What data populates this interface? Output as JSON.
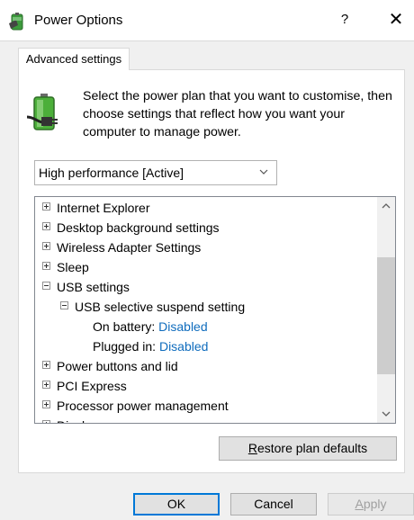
{
  "window": {
    "title": "Power Options",
    "help_label": "?",
    "close_label": "✕"
  },
  "tabs": [
    {
      "label": "Advanced settings"
    }
  ],
  "description": "Select the power plan that you want to customise, then choose settings that reflect how you want your computer to manage power.",
  "plan_select": {
    "value": "High performance [Active]"
  },
  "settings_tree": {
    "items": [
      {
        "label": "Internet Explorer",
        "expander": "plus"
      },
      {
        "label": "Desktop background settings",
        "expander": "plus"
      },
      {
        "label": "Wireless Adapter Settings",
        "expander": "plus"
      },
      {
        "label": "Sleep",
        "expander": "plus"
      },
      {
        "label": "USB settings",
        "expander": "minus"
      },
      {
        "label": "USB selective suspend setting",
        "expander": "minus"
      },
      {
        "label": "On battery:",
        "value": "Disabled"
      },
      {
        "label": "Plugged in:",
        "value": "Disabled"
      },
      {
        "label": "Power buttons and lid",
        "expander": "plus"
      },
      {
        "label": "PCI Express",
        "expander": "plus"
      },
      {
        "label": "Processor power management",
        "expander": "plus"
      },
      {
        "label": "Display",
        "expander": "plus"
      }
    ]
  },
  "buttons": {
    "restore_mnemonic": "R",
    "restore_rest": "estore plan defaults",
    "ok": "OK",
    "cancel": "Cancel",
    "apply_mnemonic": "A",
    "apply_rest": "pply"
  },
  "colors": {
    "link": "#0f6cbd",
    "focus_border": "#0078d7"
  }
}
